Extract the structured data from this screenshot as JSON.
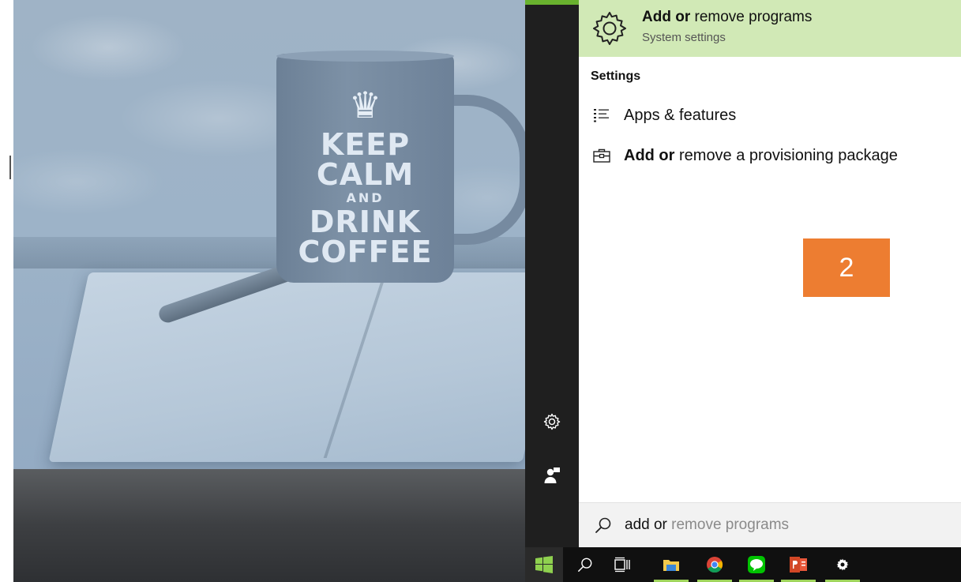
{
  "wallpaper": {
    "mug_text": [
      "KEEP",
      "CALM",
      "AND",
      "DRINK",
      "COFFEE"
    ]
  },
  "start_menu": {
    "best_match": {
      "title_bold": "Add or",
      "title_rest": " remove programs",
      "subtitle": "System settings",
      "icon": "gear-icon"
    },
    "settings_header": "Settings",
    "results": [
      {
        "icon": "list-icon",
        "label_bold": "",
        "label_rest": "Apps & features"
      },
      {
        "icon": "briefcase-icon",
        "label_bold": "Add or",
        "label_rest": " remove a provisioning package"
      }
    ],
    "rail": {
      "settings_icon": "gear-icon",
      "user_icon": "user-icon"
    },
    "search": {
      "typed": "add or",
      "suggestion": " remove programs",
      "icon": "search-icon"
    }
  },
  "annotation_badge": "2",
  "taskbar": {
    "items": [
      "start",
      "search",
      "task-view",
      "file-explorer",
      "chrome",
      "line",
      "powerpoint",
      "settings"
    ]
  },
  "colors": {
    "best_match_bg": "#d1e9b6",
    "badge_bg": "#ed7d31",
    "taskbar_bg": "#101010",
    "rail_bg": "#1f1f1f",
    "running_indicator": "#9fd45c"
  }
}
